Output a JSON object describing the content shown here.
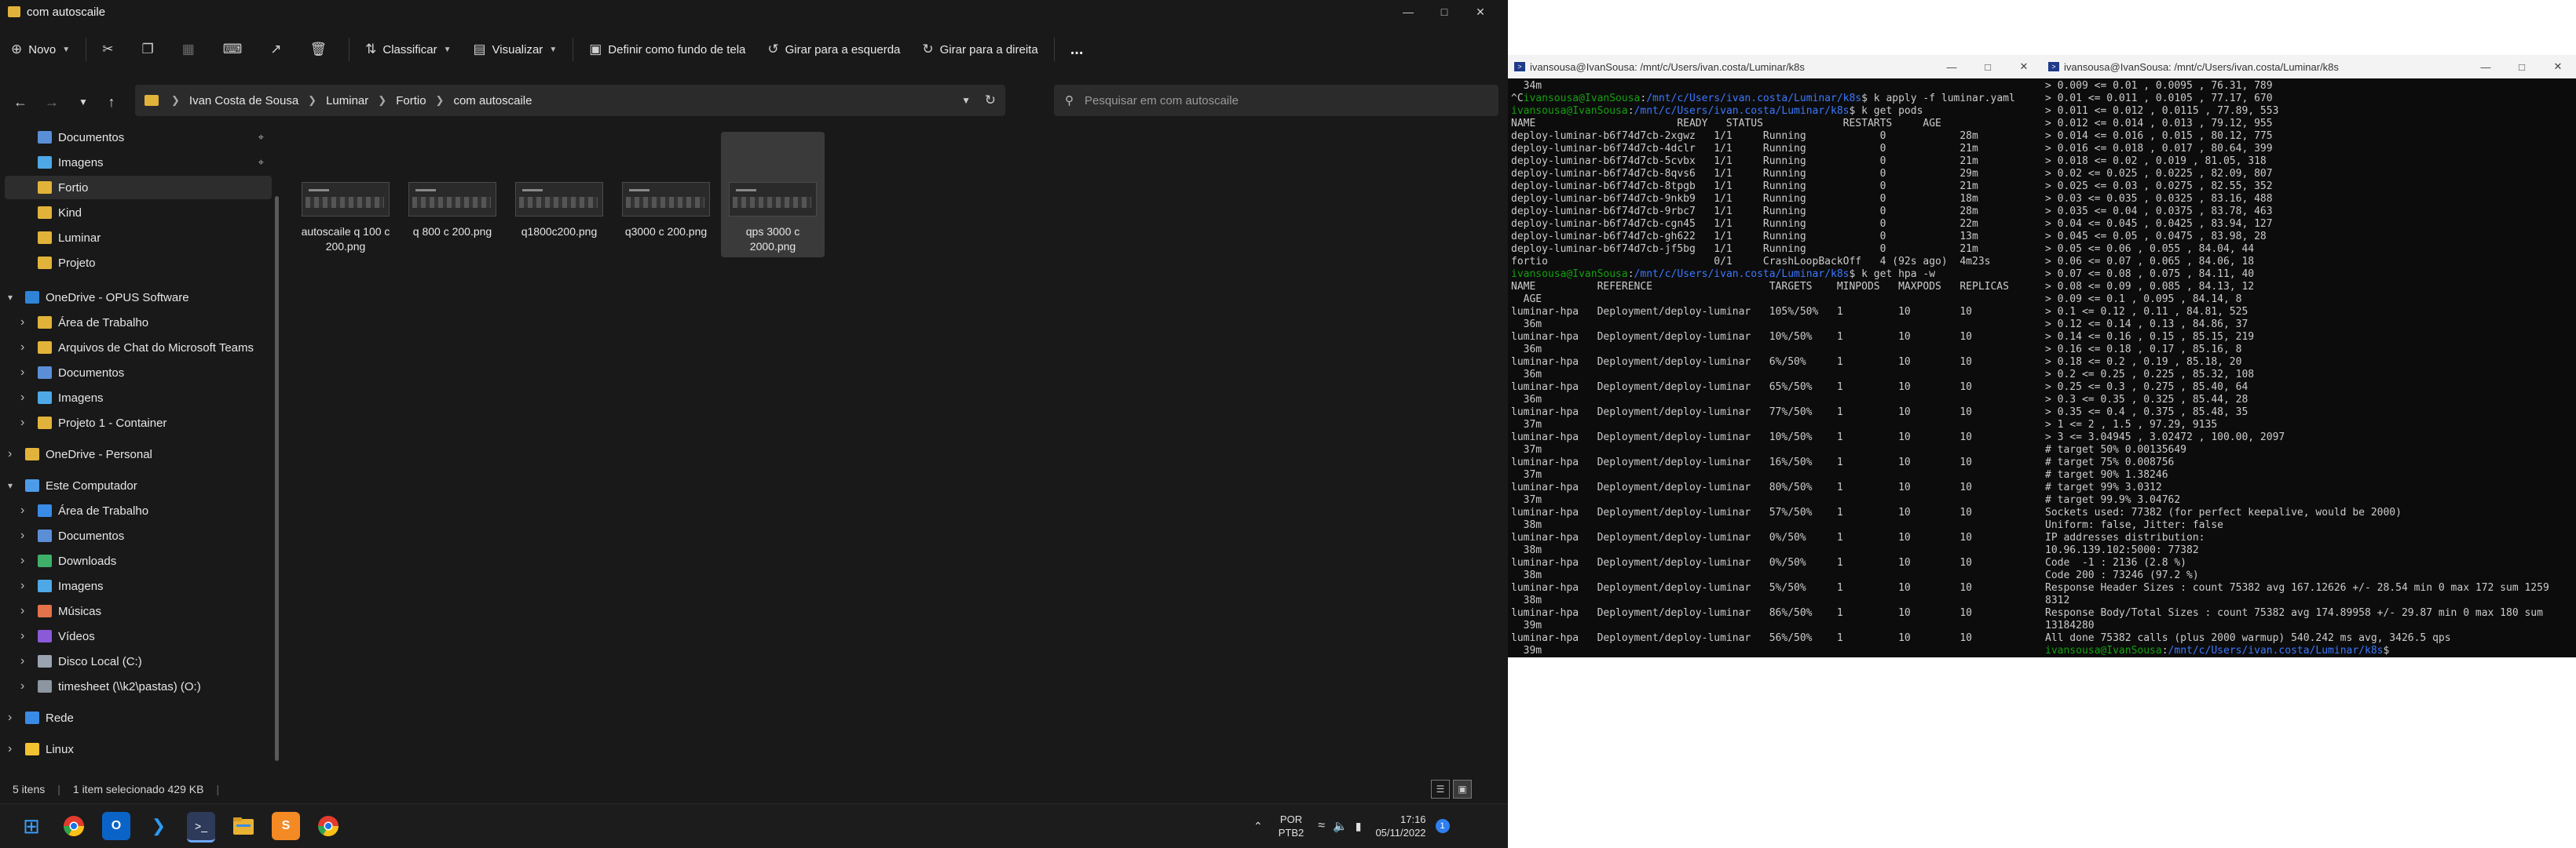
{
  "explorer": {
    "title": "com autoscaile",
    "toolbar": {
      "new_label": "Novo",
      "sort_label": "Classificar",
      "view_label": "Visualizar",
      "set_wallpaper_label": "Definir como fundo de tela",
      "rotate_left_label": "Girar para a esquerda",
      "rotate_right_label": "Girar para a direita",
      "more_label": "..."
    },
    "breadcrumb": [
      "Ivan Costa de Sousa",
      "Luminar",
      "Fortio",
      "com autoscaile"
    ],
    "search_placeholder": "Pesquisar em com autoscaile",
    "sidebar": [
      {
        "label": "Documentos",
        "icon": "document-icon",
        "pinned": true
      },
      {
        "label": "Imagens",
        "icon": "image-icon",
        "pinned": true
      },
      {
        "label": "Fortio",
        "icon": "folder-icon",
        "selected": true
      },
      {
        "label": "Kind",
        "icon": "folder-icon"
      },
      {
        "label": "Luminar",
        "icon": "folder-icon"
      },
      {
        "label": "Projeto",
        "icon": "folder-icon"
      },
      {
        "label": "OneDrive - OPUS Software",
        "icon": "cloud-icon",
        "expanded": true
      },
      {
        "label": "Área de Trabalho",
        "icon": "folder-icon"
      },
      {
        "label": "Arquivos de Chat do Microsoft Teams",
        "icon": "folder-icon"
      },
      {
        "label": "Documentos",
        "icon": "document-icon"
      },
      {
        "label": "Imagens",
        "icon": "image-icon"
      },
      {
        "label": "Projeto 1 - Container",
        "icon": "folder-icon"
      },
      {
        "label": "OneDrive - Personal",
        "icon": "folder-icon"
      },
      {
        "label": "Este Computador",
        "icon": "computer-icon",
        "expanded": true
      },
      {
        "label": "Área de Trabalho",
        "icon": "desktop-icon"
      },
      {
        "label": "Documentos",
        "icon": "document-icon"
      },
      {
        "label": "Downloads",
        "icon": "download-icon"
      },
      {
        "label": "Imagens",
        "icon": "image-icon"
      },
      {
        "label": "Músicas",
        "icon": "music-icon"
      },
      {
        "label": "Vídeos",
        "icon": "video-icon"
      },
      {
        "label": "Disco Local (C:)",
        "icon": "drive-icon"
      },
      {
        "label": "timesheet (\\\\k2\\pastas) (O:)",
        "icon": "network-drive-icon"
      },
      {
        "label": "Rede",
        "icon": "network-icon"
      },
      {
        "label": "Linux",
        "icon": "linux-icon"
      }
    ],
    "files": [
      {
        "name": "autoscaile q 100 c 200.png"
      },
      {
        "name": "q 800 c 200.png"
      },
      {
        "name": "q1800c200.png"
      },
      {
        "name": "q3000 c 200.png"
      },
      {
        "name": "qps 3000 c 2000.png",
        "selected": true
      }
    ],
    "status": {
      "items": "5 itens",
      "selection": "1 item selecionado  429 KB"
    }
  },
  "taskbar": {
    "lang": "POR",
    "kbd": "PTB2",
    "time": "17:16",
    "date": "05/11/2022",
    "notif": "1",
    "apps": [
      "windows-start-icon",
      "chrome-icon",
      "outlook-icon",
      "vscode-icon",
      "terminal-icon",
      "file-explorer-icon",
      "sublime-icon",
      "chrome-icon"
    ]
  },
  "terminal1": {
    "title": "ivansousa@IvanSousa: /mnt/c/Users/ivan.costa/Luminar/k8s",
    "lines": [
      "  34m",
      "^Civansousa@IvanSousa:/mnt/c/Users/ivan.costa/Luminar/k8s$ k apply -f luminar.yaml",
      "ivansousa@IvanSousa:/mnt/c/Users/ivan.costa/Luminar/k8s$ k get pods",
      "NAME                       READY   STATUS             RESTARTS     AGE",
      "deploy-luminar-b6f74d7cb-2xgwz   1/1     Running            0            28m",
      "deploy-luminar-b6f74d7cb-4dclr   1/1     Running            0            21m",
      "deploy-luminar-b6f74d7cb-5cvbx   1/1     Running            0            21m",
      "deploy-luminar-b6f74d7cb-8qvs6   1/1     Running            0            29m",
      "deploy-luminar-b6f74d7cb-8tpgb   1/1     Running            0            21m",
      "deploy-luminar-b6f74d7cb-9nkb9   1/1     Running            0            18m",
      "deploy-luminar-b6f74d7cb-9rbc7   1/1     Running            0            28m",
      "deploy-luminar-b6f74d7cb-cgn45   1/1     Running            0            22m",
      "deploy-luminar-b6f74d7cb-gh622   1/1     Running            0            13m",
      "deploy-luminar-b6f74d7cb-jf5bg   1/1     Running            0            21m",
      "fortio                           0/1     CrashLoopBackOff   4 (92s ago)  4m23s",
      "ivansousa@IvanSousa:/mnt/c/Users/ivan.costa/Luminar/k8s$ k get hpa -w",
      "NAME          REFERENCE                   TARGETS    MINPODS   MAXPODS   REPLICAS",
      "  AGE",
      "luminar-hpa   Deployment/deploy-luminar   105%/50%   1         10        10",
      "  36m",
      "luminar-hpa   Deployment/deploy-luminar   10%/50%    1         10        10",
      "  36m",
      "luminar-hpa   Deployment/deploy-luminar   6%/50%     1         10        10",
      "  36m",
      "luminar-hpa   Deployment/deploy-luminar   65%/50%    1         10        10",
      "  36m",
      "luminar-hpa   Deployment/deploy-luminar   77%/50%    1         10        10",
      "  37m",
      "luminar-hpa   Deployment/deploy-luminar   10%/50%    1         10        10",
      "  37m",
      "luminar-hpa   Deployment/deploy-luminar   16%/50%    1         10        10",
      "  37m",
      "luminar-hpa   Deployment/deploy-luminar   80%/50%    1         10        10",
      "  37m",
      "luminar-hpa   Deployment/deploy-luminar   57%/50%    1         10        10",
      "  38m",
      "luminar-hpa   Deployment/deploy-luminar   0%/50%     1         10        10",
      "  38m",
      "luminar-hpa   Deployment/deploy-luminar   0%/50%     1         10        10",
      "  38m",
      "luminar-hpa   Deployment/deploy-luminar   5%/50%     1         10        10",
      "  38m",
      "luminar-hpa   Deployment/deploy-luminar   86%/50%    1         10        10",
      "  39m",
      "luminar-hpa   Deployment/deploy-luminar   56%/50%    1         10        10",
      "  39m"
    ]
  },
  "terminal2": {
    "title": "ivansousa@IvanSousa: /mnt/c/Users/ivan.costa/Luminar/k8s",
    "lines": [
      "> 0.009 <= 0.01 , 0.0095 , 76.31, 789",
      "> 0.01 <= 0.011 , 0.0105 , 77.17, 670",
      "> 0.011 <= 0.012 , 0.0115 , 77.89, 553",
      "> 0.012 <= 0.014 , 0.013 , 79.12, 955",
      "> 0.014 <= 0.016 , 0.015 , 80.12, 775",
      "> 0.016 <= 0.018 , 0.017 , 80.64, 399",
      "> 0.018 <= 0.02 , 0.019 , 81.05, 318",
      "> 0.02 <= 0.025 , 0.0225 , 82.09, 807",
      "> 0.025 <= 0.03 , 0.0275 , 82.55, 352",
      "> 0.03 <= 0.035 , 0.0325 , 83.16, 488",
      "> 0.035 <= 0.04 , 0.0375 , 83.78, 463",
      "> 0.04 <= 0.045 , 0.0425 , 83.94, 127",
      "> 0.045 <= 0.05 , 0.0475 , 83.98, 28",
      "> 0.05 <= 0.06 , 0.055 , 84.04, 44",
      "> 0.06 <= 0.07 , 0.065 , 84.06, 18",
      "> 0.07 <= 0.08 , 0.075 , 84.11, 40",
      "> 0.08 <= 0.09 , 0.085 , 84.13, 12",
      "> 0.09 <= 0.1 , 0.095 , 84.14, 8",
      "> 0.1 <= 0.12 , 0.11 , 84.81, 525",
      "> 0.12 <= 0.14 , 0.13 , 84.86, 37",
      "> 0.14 <= 0.16 , 0.15 , 85.15, 219",
      "> 0.16 <= 0.18 , 0.17 , 85.16, 8",
      "> 0.18 <= 0.2 , 0.19 , 85.18, 20",
      "> 0.2 <= 0.25 , 0.225 , 85.32, 108",
      "> 0.25 <= 0.3 , 0.275 , 85.40, 64",
      "> 0.3 <= 0.35 , 0.325 , 85.44, 28",
      "> 0.35 <= 0.4 , 0.375 , 85.48, 35",
      "> 1 <= 2 , 1.5 , 97.29, 9135",
      "> 3 <= 3.04945 , 3.02472 , 100.00, 2097",
      "# target 50% 0.00135649",
      "# target 75% 0.008756",
      "# target 90% 1.38246",
      "# target 99% 3.0312",
      "# target 99.9% 3.04762",
      "Sockets used: 77382 (for perfect keepalive, would be 2000)",
      "Uniform: false, Jitter: false",
      "IP addresses distribution:",
      "10.96.139.102:5000: 77382",
      "Code  -1 : 2136 (2.8 %)",
      "Code 200 : 73246 (97.2 %)",
      "Response Header Sizes : count 75382 avg 167.12626 +/- 28.54 min 0 max 172 sum 1259",
      "8312",
      "Response Body/Total Sizes : count 75382 avg 174.89958 +/- 29.87 min 0 max 180 sum",
      "13184280",
      "All done 75382 calls (plus 2000 warmup) 540.242 ms avg, 3426.5 qps",
      "ivansousa@IvanSousa:/mnt/c/Users/ivan.costa/Luminar/k8s$ "
    ]
  }
}
